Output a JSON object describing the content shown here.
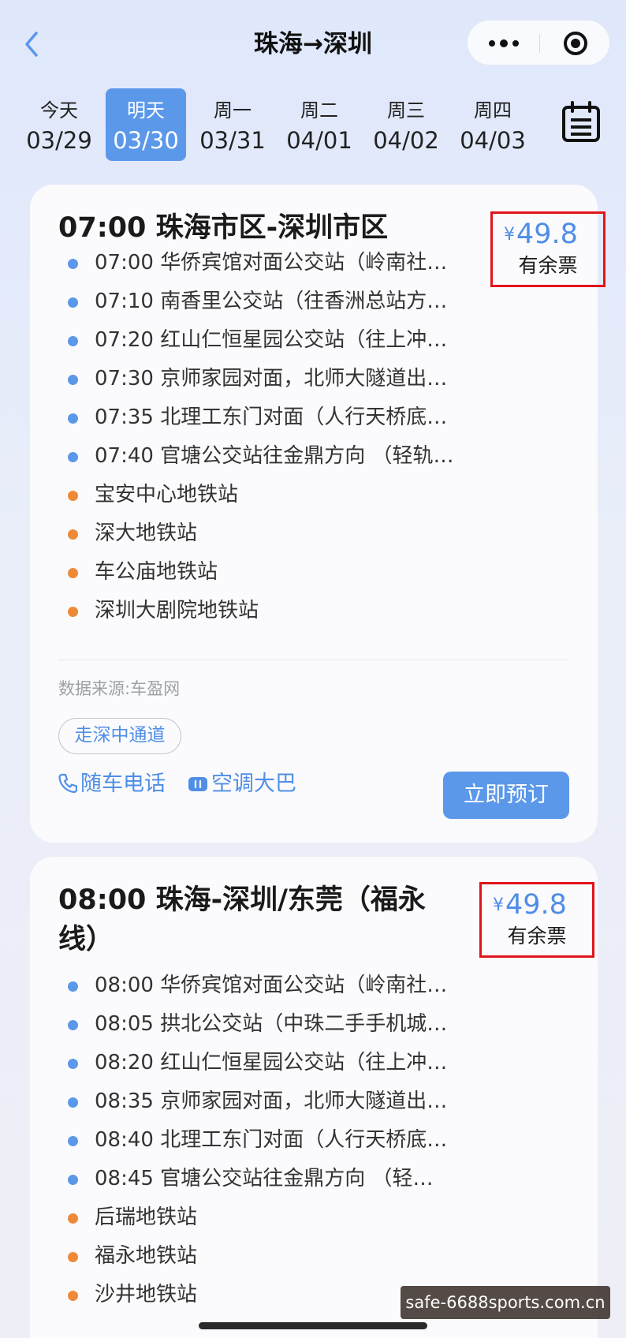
{
  "nav": {
    "title": "珠海→深圳"
  },
  "dates": [
    {
      "weekday": "今天",
      "date": "03/29",
      "active": false
    },
    {
      "weekday": "明天",
      "date": "03/30",
      "active": true
    },
    {
      "weekday": "周一",
      "date": "03/31",
      "active": false
    },
    {
      "weekday": "周二",
      "date": "04/01",
      "active": false
    },
    {
      "weekday": "周三",
      "date": "04/02",
      "active": false
    },
    {
      "weekday": "周四",
      "date": "04/03",
      "active": false
    }
  ],
  "routes": [
    {
      "title": "07:00 珠海市区-深圳市区",
      "currency": "¥",
      "price": "49.8",
      "status": "有余票",
      "stops": [
        {
          "text": "07:00 华侨宾馆对面公交站（岭南社…",
          "kind": "board"
        },
        {
          "text": "07:10 南香里公交站（往香洲总站方…",
          "kind": "board"
        },
        {
          "text": "07:20 红山仁恒星园公交站（往上冲…",
          "kind": "board"
        },
        {
          "text": "07:30 京师家园对面，北师大隧道出…",
          "kind": "board"
        },
        {
          "text": "07:35 北理工东门对面（人行天桥底…",
          "kind": "board"
        },
        {
          "text": "07:40 官塘公交站往金鼎方向 （轻轨…",
          "kind": "board"
        },
        {
          "text": "宝安中心地铁站",
          "kind": "alight"
        },
        {
          "text": "深大地铁站",
          "kind": "alight"
        },
        {
          "text": "车公庙地铁站",
          "kind": "alight"
        },
        {
          "text": "深圳大剧院地铁站",
          "kind": "alight"
        }
      ],
      "source": "数据来源:车盈网",
      "tag": "走深中通道",
      "amenity_phone": "随车电话",
      "amenity_ac": "空调大巴",
      "book_label": "立即预订"
    },
    {
      "title": "08:00 珠海-深圳/东莞（福永线）",
      "currency": "¥",
      "price": "49.8",
      "status": "有余票",
      "stops": [
        {
          "text": "08:00 华侨宾馆对面公交站（岭南社…",
          "kind": "board"
        },
        {
          "text": "08:05 拱北公交站（中珠二手手机城…",
          "kind": "board"
        },
        {
          "text": "08:20 红山仁恒星园公交站（往上冲…",
          "kind": "board"
        },
        {
          "text": "08:35 京师家园对面，北师大隧道出…",
          "kind": "board"
        },
        {
          "text": "08:40 北理工东门对面（人行天桥底…",
          "kind": "board"
        },
        {
          "text": "08:45 官塘公交站往金鼎方向 （轻…",
          "kind": "board"
        },
        {
          "text": "后瑞地铁站",
          "kind": "alight"
        },
        {
          "text": "福永地铁站",
          "kind": "alight"
        },
        {
          "text": "沙井地铁站",
          "kind": "alight"
        }
      ]
    }
  ],
  "watermark": "safe-6688sports.com.cn",
  "colors": {
    "accent": "#5b98e9",
    "price": "#4f8ee6",
    "board_dot": "#5b98e9",
    "alight_dot": "#ee8a37",
    "highlight_box": "#e0151b"
  }
}
